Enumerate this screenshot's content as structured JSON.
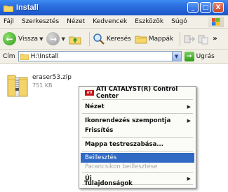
{
  "window": {
    "title": "Install",
    "controls": [
      "_",
      "□",
      "X"
    ]
  },
  "menubar": {
    "items": [
      "Fájl",
      "Szerkesztés",
      "Nézet",
      "Kedvencek",
      "Eszközök",
      "Súgó"
    ]
  },
  "toolbar": {
    "back_label": "Vissza",
    "search_label": "Keresés",
    "folders_label": "Mappák",
    "more": "»"
  },
  "address": {
    "label": "Cím",
    "path": "H:\\Install",
    "go_label": "Ugrás"
  },
  "file": {
    "name": "eraser53.zip",
    "size": "751 KB"
  },
  "context_menu": {
    "items": [
      {
        "label": "ATI CATALYST(R) Control Center",
        "badge": "ATI"
      },
      {
        "label": "Nézet"
      },
      {
        "label": "Ikonrendezés szempontja"
      },
      {
        "label": "Frissítés"
      },
      {
        "label": "Mappa testreszabása..."
      },
      {
        "label": "Beillesztés"
      },
      {
        "label": "Parancsikon beillesztése"
      },
      {
        "label": "Új"
      },
      {
        "label": "Tulajdonságok"
      }
    ]
  },
  "colors": {
    "title_bar": "#2c6ee0",
    "highlight": "#316ac5",
    "window_bg": "#f1efe6"
  }
}
